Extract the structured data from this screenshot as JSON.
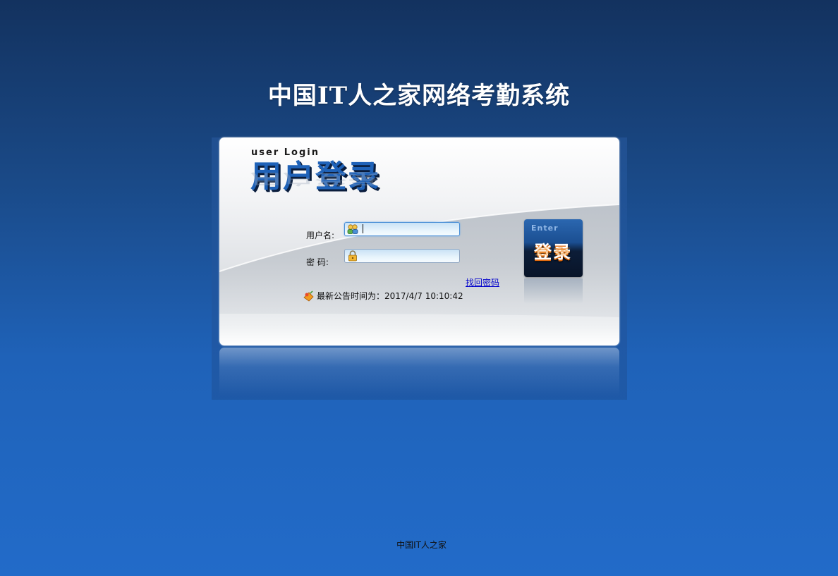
{
  "page": {
    "title": "中国IT人之家网络考勤系统",
    "footer": "中国IT人之家"
  },
  "login_panel": {
    "heading_en": "user Login",
    "heading_cn": "用户登录",
    "username_label": "用户名:",
    "username_value": "",
    "password_label": "密  码:",
    "password_value": "",
    "forgot_password_link": "找回密码",
    "notice_text": "最新公告时间为：2017/4/7 10:10:42",
    "enter_button_en": "Enter",
    "enter_button_cn": "登录"
  },
  "icons": {
    "username": "users-icon",
    "password": "lock-icon",
    "notice": "announcement-icon"
  },
  "colors": {
    "background_top": "#13325f",
    "background_bottom": "#226bc9",
    "accent": "#1f62b8",
    "link": "#0000cc",
    "button_glow": "#e06a10"
  }
}
